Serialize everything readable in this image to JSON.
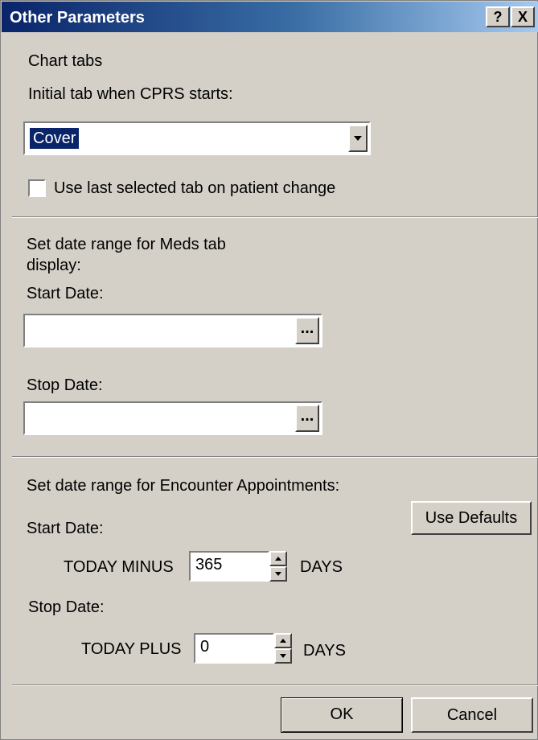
{
  "window": {
    "title": "Other Parameters",
    "help_label": "?",
    "close_label": "X"
  },
  "chart_tabs": {
    "heading": "Chart tabs",
    "initial_tab_label": "Initial tab when CPRS starts:",
    "initial_tab_value": "Cover",
    "use_last_label": "Use last selected tab on patient change",
    "use_last_checked": false
  },
  "meds": {
    "heading_line1": "Set date range for Meds tab",
    "heading_line2": "display:",
    "start_label": "Start Date:",
    "start_value": "",
    "stop_label": "Stop Date:",
    "stop_value": "",
    "browse_label": "..."
  },
  "encounter": {
    "heading": "Set date range for Encounter Appointments:",
    "use_defaults_label": "Use Defaults",
    "start_label": "Start Date:",
    "today_minus_label": "TODAY MINUS",
    "minus_value": "365",
    "days_label": "DAYS",
    "stop_label": "Stop Date:",
    "today_plus_label": "TODAY PLUS",
    "plus_value": "0"
  },
  "buttons": {
    "ok_label": "OK",
    "cancel_label": "Cancel"
  }
}
